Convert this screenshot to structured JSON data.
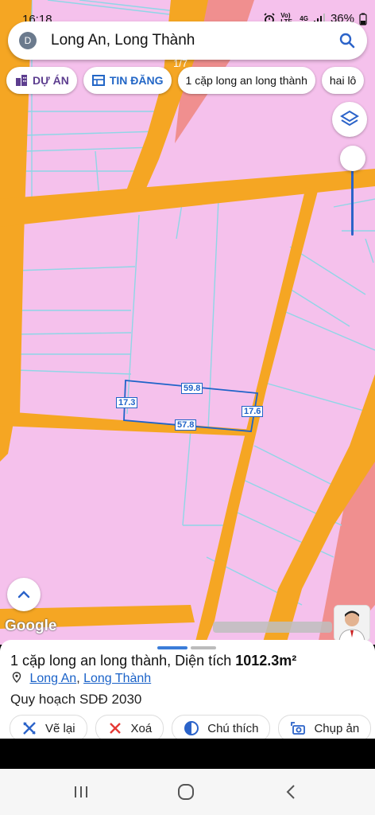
{
  "status": {
    "time": "16:18",
    "network": "4G",
    "volte": "Vo) LTE",
    "battery": "36%"
  },
  "search": {
    "avatar_letter": "D",
    "query": "Long An, Long Thành"
  },
  "chips": [
    {
      "label": "DỰ ÁN"
    },
    {
      "label": "TIN ĐĂNG"
    },
    {
      "label": "1 cặp long an long thành"
    },
    {
      "label": "hai lô"
    }
  ],
  "map": {
    "count_overlay": "1/7",
    "measurements": {
      "top": "59.8",
      "left": "17.3",
      "right": "17.6",
      "bottom": "57.8"
    },
    "attribution": "Google",
    "colors": {
      "land": "#f5c1ec",
      "road": "#f5a623",
      "parcel": "#8fd6e6",
      "measure": "#1e63c8"
    }
  },
  "sheet": {
    "title_prefix": "1 cặp long an long thành, Diện tích ",
    "area": "1012.3m²",
    "location_a": "Long An",
    "location_sep": ", ",
    "location_b": "Long Thành",
    "plan": "Quy hoạch SDĐ 2030",
    "actions": [
      {
        "label": "Vẽ lại",
        "icon": "ruler-icon"
      },
      {
        "label": "Xoá",
        "icon": "close-icon"
      },
      {
        "label": "Chú thích",
        "icon": "contrast-icon"
      },
      {
        "label": "Chụp ản",
        "icon": "camera-icon"
      }
    ]
  }
}
